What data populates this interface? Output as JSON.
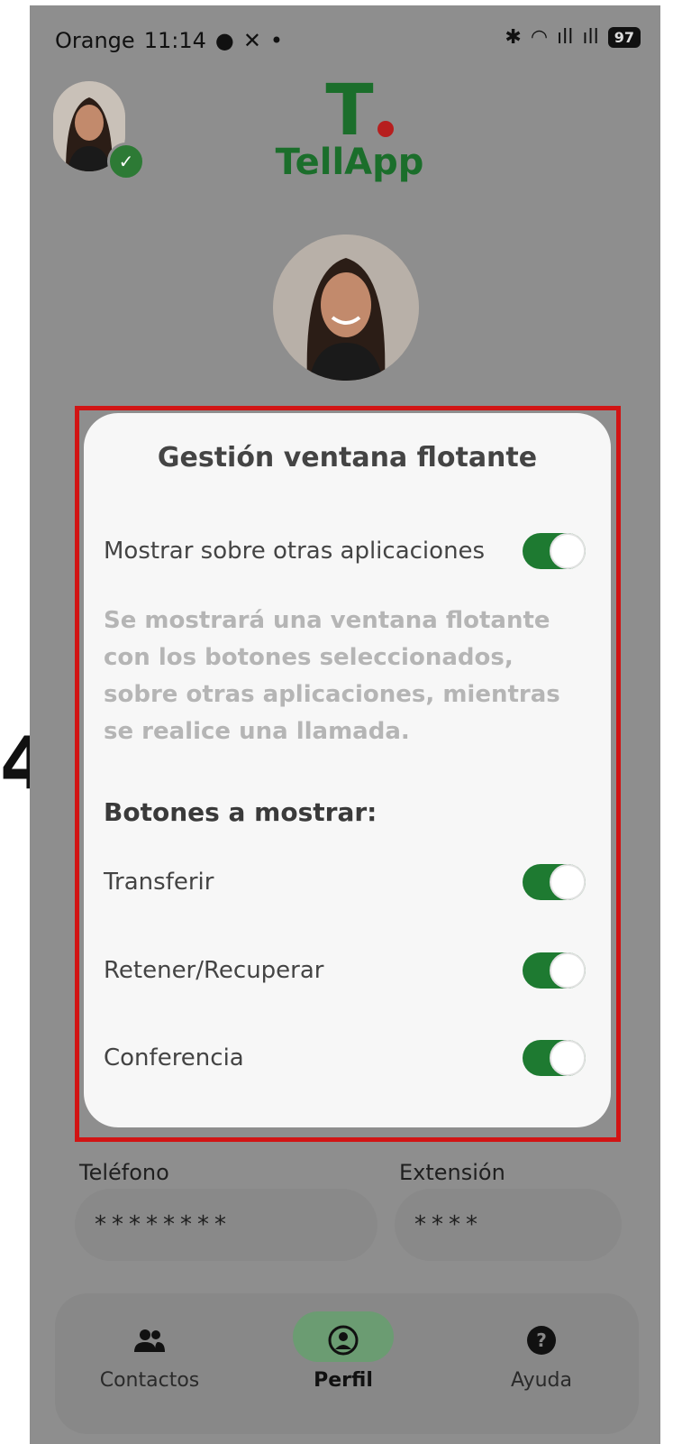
{
  "status_bar": {
    "carrier": "Orange",
    "time": "11:14",
    "battery": "97"
  },
  "header": {
    "logo_letter": "T",
    "logo_text": "TellApp"
  },
  "modal": {
    "title": "Gestión ventana flotante",
    "show_over_apps": {
      "label": "Mostrar sobre otras aplicaciones",
      "on": true
    },
    "description": "Se mostrará una ventana flotante con los botones seleccionados, sobre otras aplicaciones, mientras se realice una llamada.",
    "buttons_heading": "Botones a mostrar:",
    "options": [
      {
        "label": "Transferir",
        "on": true
      },
      {
        "label": "Retener/Recuperar",
        "on": true
      },
      {
        "label": "Conferencia",
        "on": true
      }
    ]
  },
  "fields": {
    "phone_label": "Teléfono",
    "phone_value": "********",
    "extension_label": "Extensión",
    "extension_value": "****"
  },
  "nav": {
    "items": [
      {
        "label": "Contactos",
        "icon": "contacts-icon"
      },
      {
        "label": "Perfil",
        "icon": "profile-icon",
        "active": true
      },
      {
        "label": "Ayuda",
        "icon": "help-icon"
      }
    ]
  },
  "annotation": "4",
  "colors": {
    "accent": "#1e7a31",
    "highlight_border": "#d11414"
  }
}
